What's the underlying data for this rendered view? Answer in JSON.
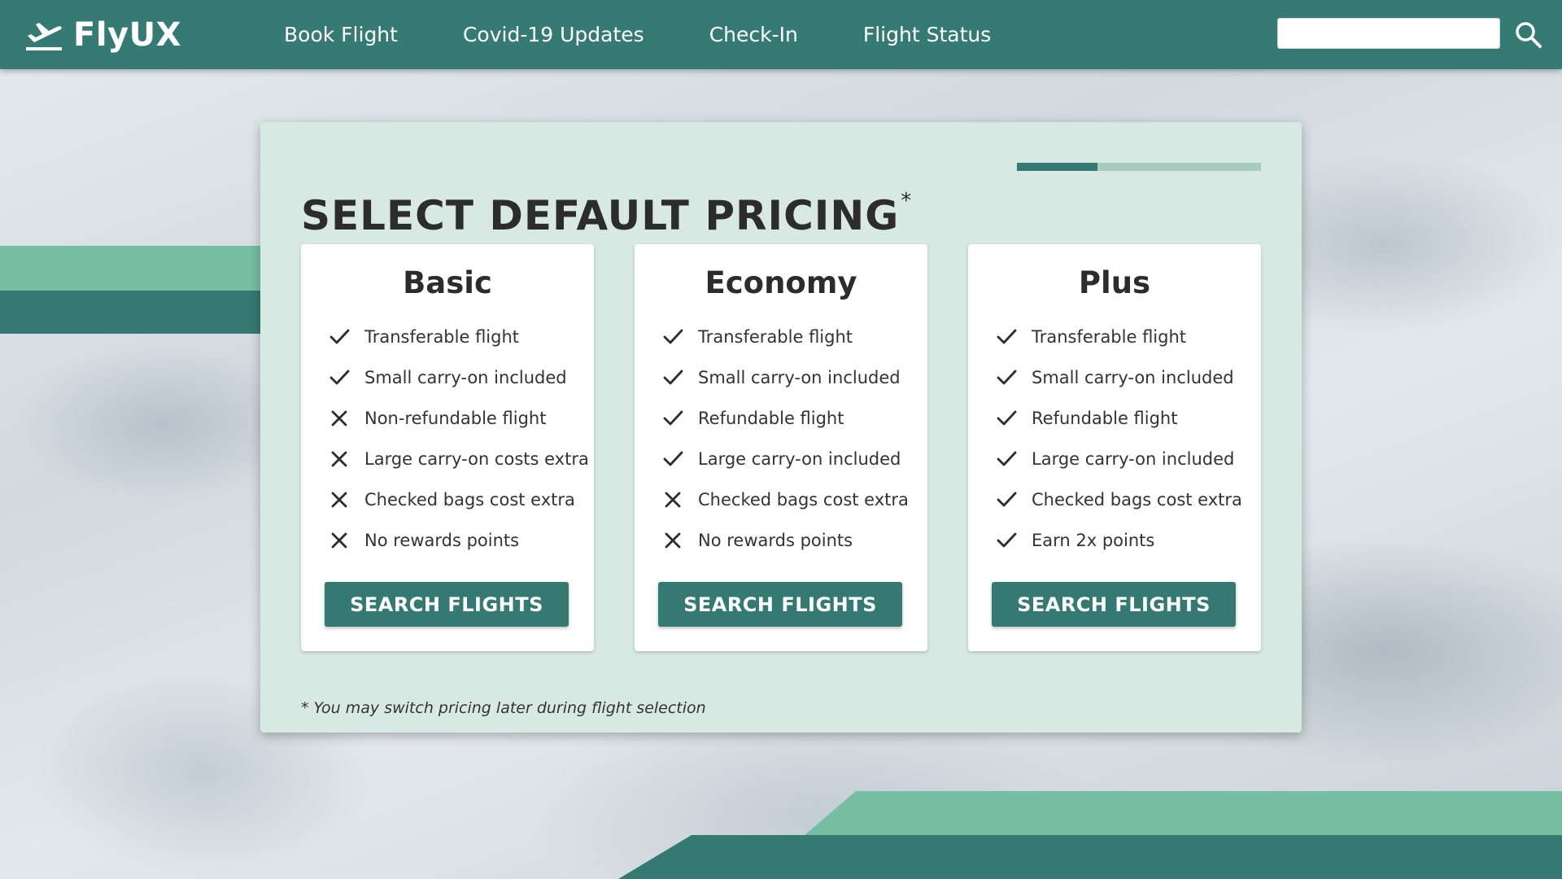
{
  "nav": {
    "brand": "FlyUX",
    "links": [
      "Book Flight",
      "Covid-19 Updates",
      "Check-In",
      "Flight Status"
    ],
    "search_value": ""
  },
  "colors": {
    "primary": "#357a73",
    "accent_light": "#76bea4",
    "panel_bg": "#d8e9e3"
  },
  "panel": {
    "title": "SELECT DEFAULT PRICING",
    "title_mark": "*",
    "progress": 0.33,
    "footnote": "* You may switch pricing later during flight selection"
  },
  "plans": [
    {
      "name": "Basic",
      "button": "SEARCH FLIGHTS",
      "features": [
        {
          "text": "Transferable flight",
          "included": true
        },
        {
          "text": "Small carry-on included",
          "included": true
        },
        {
          "text": "Non-refundable flight",
          "included": false
        },
        {
          "text": "Large carry-on costs extra",
          "included": false
        },
        {
          "text": "Checked bags cost extra",
          "included": false
        },
        {
          "text": "No rewards points",
          "included": false
        }
      ]
    },
    {
      "name": "Economy",
      "button": "SEARCH FLIGHTS",
      "features": [
        {
          "text": "Transferable flight",
          "included": true
        },
        {
          "text": "Small carry-on included",
          "included": true
        },
        {
          "text": "Refundable flight",
          "included": true
        },
        {
          "text": "Large carry-on included",
          "included": true
        },
        {
          "text": "Checked bags cost extra",
          "included": false
        },
        {
          "text": "No rewards points",
          "included": false
        }
      ]
    },
    {
      "name": "Plus",
      "button": "SEARCH FLIGHTS",
      "features": [
        {
          "text": "Transferable flight",
          "included": true
        },
        {
          "text": "Small carry-on included",
          "included": true
        },
        {
          "text": "Refundable flight",
          "included": true
        },
        {
          "text": "Large carry-on included",
          "included": true
        },
        {
          "text": "Checked bags cost extra",
          "included": true
        },
        {
          "text": "Earn 2x points",
          "included": true
        }
      ]
    }
  ]
}
